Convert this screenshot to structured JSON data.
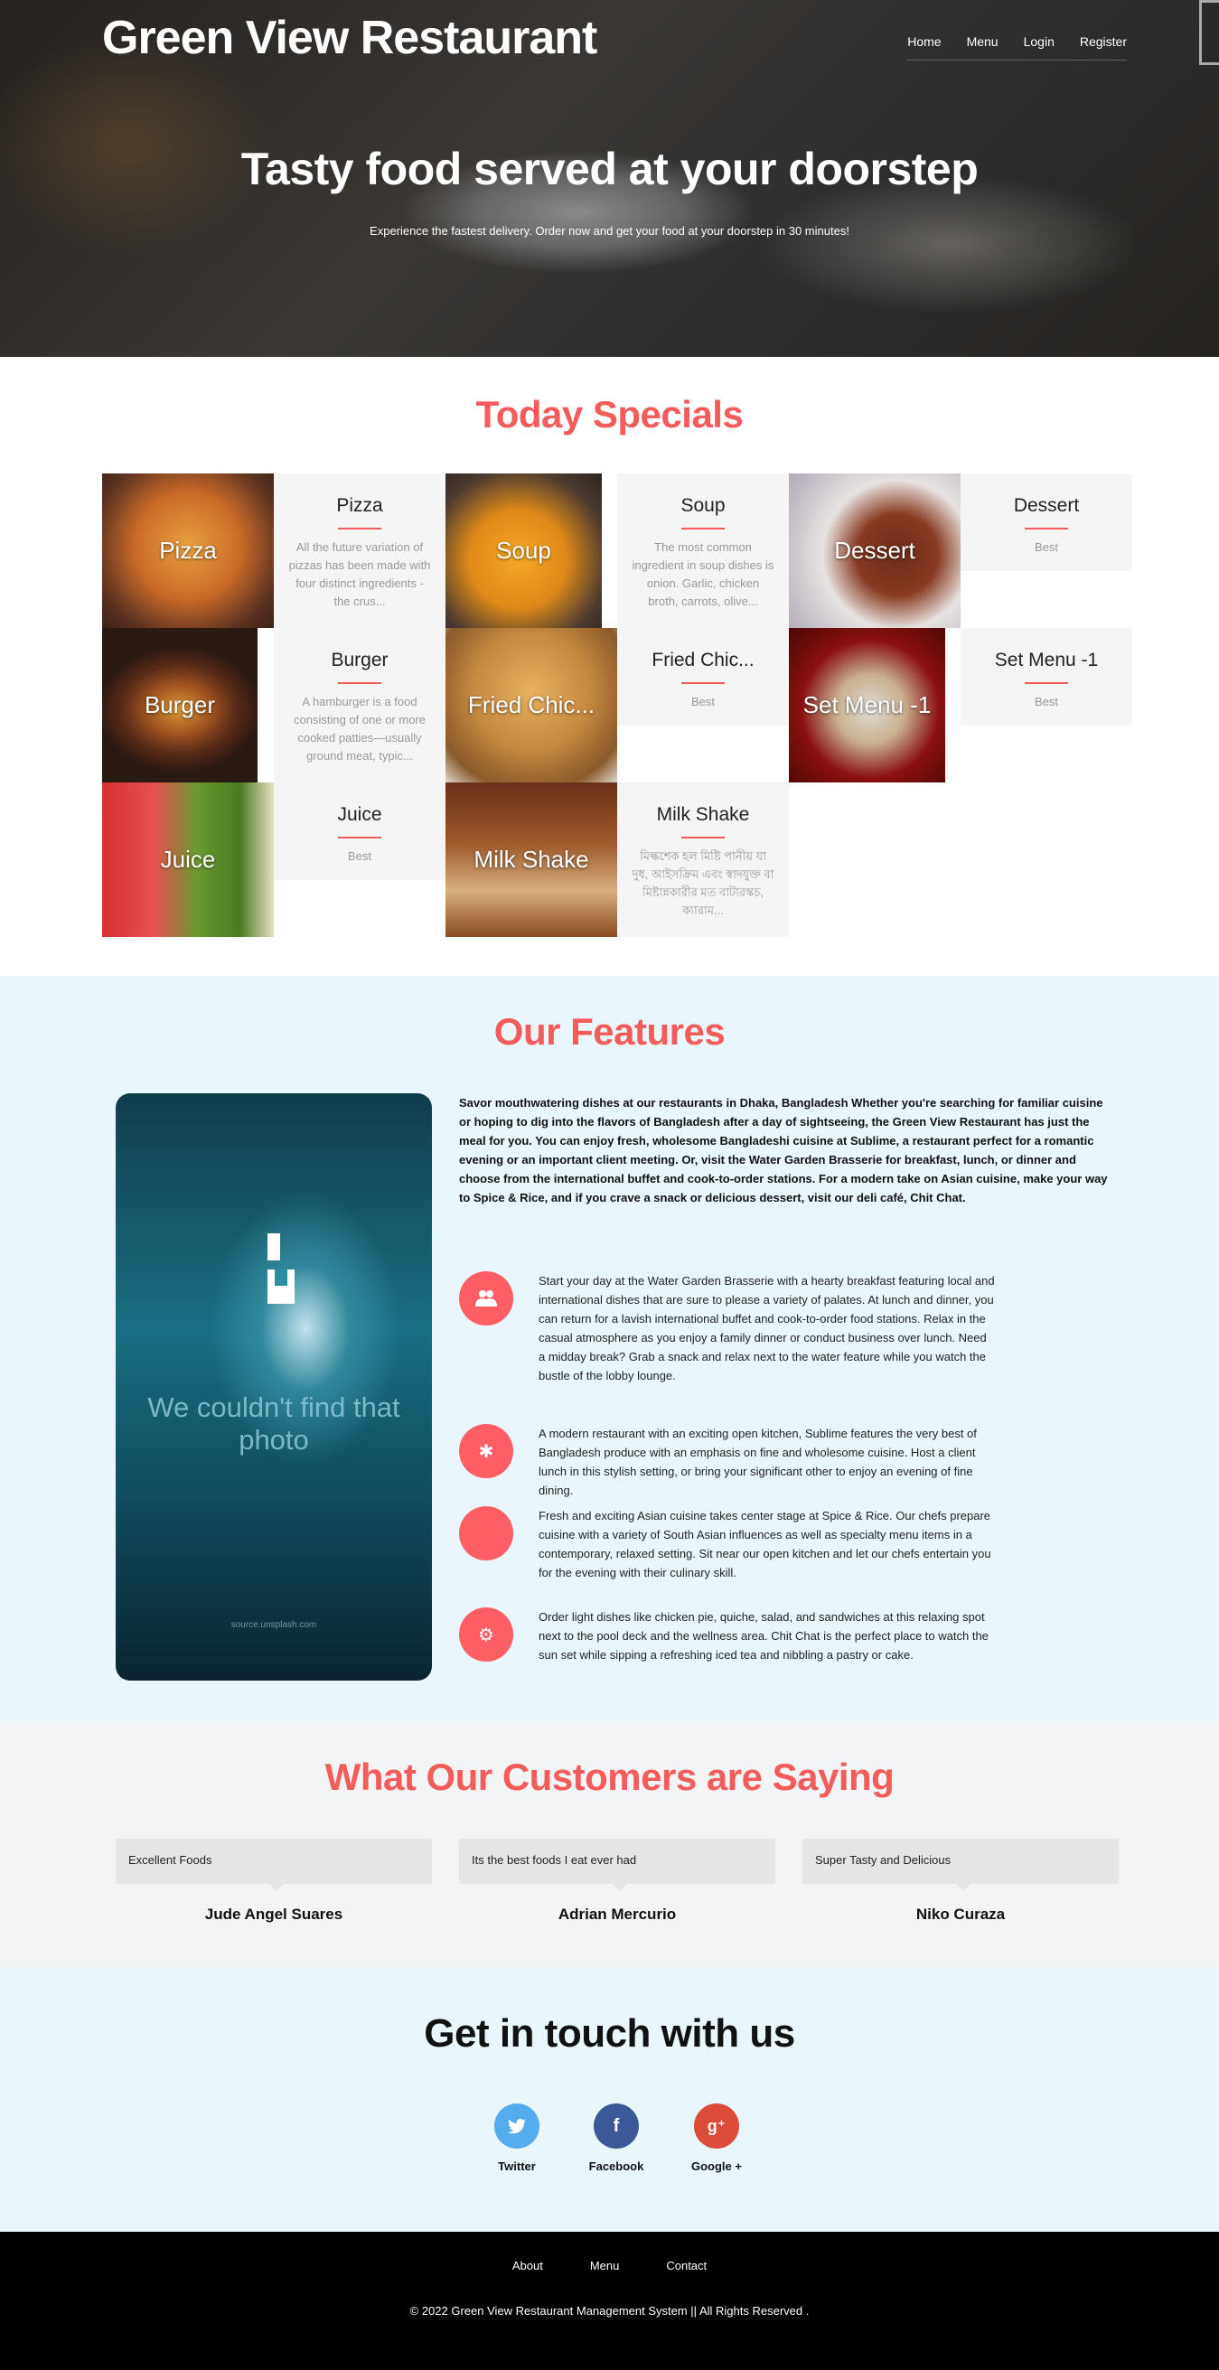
{
  "header": {
    "brand": "Green View Restaurant",
    "nav": [
      "Home",
      "Menu",
      "Login",
      "Register"
    ]
  },
  "hero": {
    "title": "Tasty food served at your doorstep",
    "subtitle": "Experience the fastest delivery. Order now and get your food at your doorstep in 30 minutes!"
  },
  "specials": {
    "title": "Today Specials",
    "items": [
      {
        "name": "Pizza",
        "overlay": "Pizza",
        "desc": "All the future variation of pizzas has been made with four distinct ingredients - the crus..."
      },
      {
        "name": "Soup",
        "overlay": "Soup",
        "desc": "The most common ingredient in soup dishes is onion. Garlic, chicken broth, carrots, olive..."
      },
      {
        "name": "Dessert",
        "overlay": "Dessert",
        "desc": "Best"
      },
      {
        "name": "Burger",
        "overlay": "Burger",
        "desc": "A hamburger is a food consisting of one or more cooked patties—usually ground meat, typic..."
      },
      {
        "name": "Fried Chic...",
        "overlay": "Fried Chic...",
        "desc": "Best"
      },
      {
        "name": "Set Menu -1",
        "overlay": "Set Menu -1",
        "desc": "Best"
      },
      {
        "name": "Juice",
        "overlay": "Juice",
        "desc": "Best"
      },
      {
        "name": "Milk Shake",
        "overlay": "Milk Shake",
        "desc": "মিল্কশেক হল মিষ্টি পানীয় যা দুধ, আইসক্রিম এবং স্বাদযুক্ত বা মিষ্টান্নকারীর মত বাটারস্কচ, ক্যারাম..."
      }
    ]
  },
  "features": {
    "title": "Our Features",
    "photo_message": "We couldn't find that photo",
    "photo_source": "source.unsplash.com",
    "intro": "Savor mouthwatering dishes at our restaurants in Dhaka, Bangladesh Whether you're searching for familiar cuisine or hoping to dig into the flavors of Bangladesh after a day of sightseeing, the Green View Restaurant has just the meal for you. You can enjoy fresh, wholesome Bangladeshi cuisine at Sublime, a restaurant perfect for a romantic evening or an important client meeting. Or, visit the Water Garden Brasserie for breakfast, lunch, or dinner and choose from the international buffet and cook-to-order stations. For a modern take on Asian cuisine, make your way to Spice & Rice, and if you crave a snack or delicious dessert, visit our deli café, Chit Chat.",
    "items": [
      {
        "icon": "users-icon",
        "text": "Start your day at the Water Garden Brasserie with a hearty breakfast featuring local and international dishes that are sure to please a variety of palates. At lunch and dinner, you can return for a lavish international buffet and cook-to-order food stations. Relax in the casual atmosphere as you enjoy a family dinner or conduct business over lunch. Need a midday break? Grab a snack and relax next to the water feature while you watch the bustle of the lobby lounge."
      },
      {
        "icon": "asterisk-icon",
        "text": "A modern restaurant with an exciting open kitchen, Sublime features the very best of Bangladesh produce with an emphasis on fine and wholesome cuisine. Host a client lunch in this stylish setting, or bring your significant other to enjoy an evening of fine dining."
      },
      {
        "icon": "blank-icon",
        "text": "Fresh and exciting Asian cuisine takes center stage at Spice & Rice. Our chefs prepare cuisine with a variety of South Asian influences as well as specialty menu items in a contemporary, relaxed setting. Sit near our open kitchen and let our chefs entertain you for the evening with their culinary skill."
      },
      {
        "icon": "gear-icon",
        "text": "Order light dishes like chicken pie, quiche, salad, and sandwiches at this relaxing spot next to the pool deck and the wellness area. Chit Chat is the perfect place to watch the sun set while sipping a refreshing iced tea and nibbling a pastry or cake."
      }
    ]
  },
  "testimonials": {
    "title": "What Our Customers are Saying",
    "items": [
      {
        "quote": "Excellent Foods",
        "name": "Jude Angel Suares"
      },
      {
        "quote": "Its the best foods I eat ever had",
        "name": "Adrian Mercurio"
      },
      {
        "quote": "Super Tasty and Delicious",
        "name": "Niko Curaza"
      }
    ]
  },
  "contact": {
    "title": "Get in touch with us",
    "social": [
      {
        "label": "Twitter",
        "color": "#55acee",
        "icon": "twitter-icon"
      },
      {
        "label": "Facebook",
        "color": "#3b5998",
        "icon": "facebook-icon"
      },
      {
        "label": "Google +",
        "color": "#dd4b39",
        "icon": "google-plus-icon"
      }
    ]
  },
  "footer": {
    "links": [
      "About",
      "Menu",
      "Contact"
    ],
    "copyright": "© 2022 Green View Restaurant Management System || All Rights Reserved ."
  },
  "colors": {
    "accent": "#f45b5b",
    "feature_bg": "#e9f6fc",
    "footer_bg": "#000000"
  }
}
